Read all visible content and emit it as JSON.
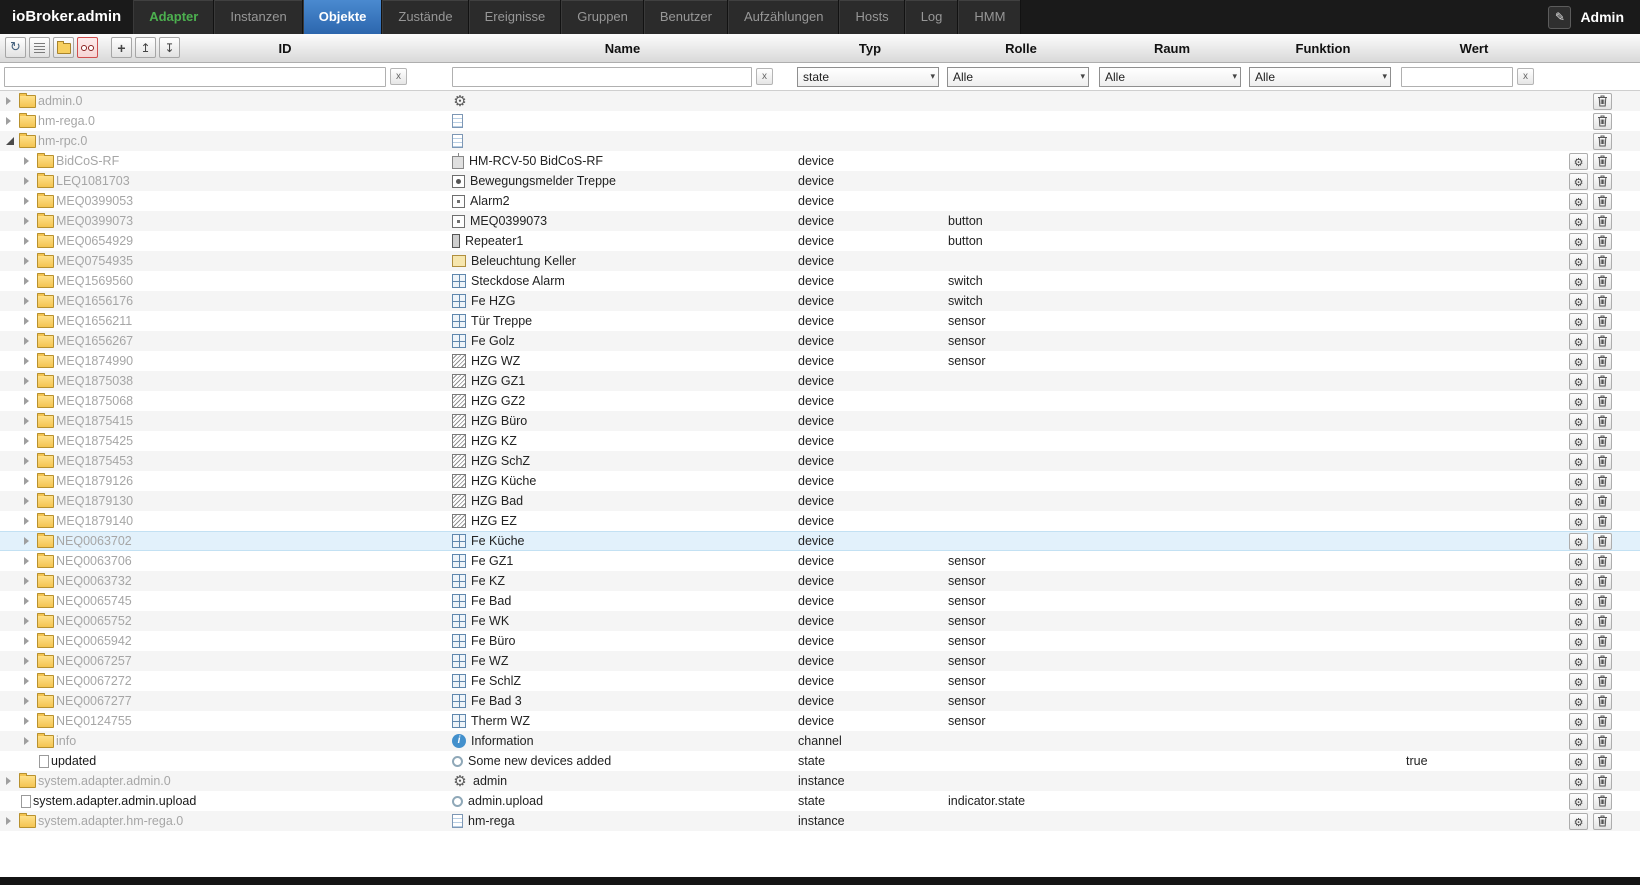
{
  "app": {
    "title": "ioBroker.admin",
    "user": "Admin"
  },
  "tabs": [
    {
      "id": "adapter",
      "label": "Adapter",
      "accent": true
    },
    {
      "id": "instanzen",
      "label": "Instanzen"
    },
    {
      "id": "objekte",
      "label": "Objekte",
      "active": true
    },
    {
      "id": "zustaende",
      "label": "Zustände"
    },
    {
      "id": "ereignisse",
      "label": "Ereignisse"
    },
    {
      "id": "gruppen",
      "label": "Gruppen"
    },
    {
      "id": "benutzer",
      "label": "Benutzer"
    },
    {
      "id": "aufzaehlungen",
      "label": "Aufzählungen"
    },
    {
      "id": "hosts",
      "label": "Hosts"
    },
    {
      "id": "log",
      "label": "Log"
    },
    {
      "id": "hmm",
      "label": "HMM"
    }
  ],
  "icons": {
    "refresh": "↻",
    "add": "+",
    "collapse_all": "↥",
    "expand_all": "↧",
    "edit_pencil": "✎",
    "clear": "x",
    "dropdown_arrow": "▾"
  },
  "columns": [
    "ID",
    "Name",
    "Typ",
    "Rolle",
    "Raum",
    "Funktion",
    "Wert"
  ],
  "filters": {
    "id_value": "",
    "name_value": "",
    "type_selected": "state",
    "role_selected": "Alle",
    "room_selected": "Alle",
    "function_selected": "Alle",
    "value_value": ""
  },
  "table": {
    "rows": [
      {
        "id": "admin.0",
        "level": 0,
        "arrow": "collapsed",
        "node": "folder",
        "virtual": true,
        "icon": "gear",
        "name": "",
        "type": "",
        "role": "",
        "value": "",
        "actions": [
          "delete"
        ]
      },
      {
        "id": "hm-rega.0",
        "level": 0,
        "arrow": "collapsed",
        "node": "folder",
        "virtual": true,
        "icon": "doc",
        "name": "",
        "type": "",
        "role": "",
        "value": "",
        "actions": [
          "delete"
        ]
      },
      {
        "id": "hm-rpc.0",
        "level": 0,
        "arrow": "expanded",
        "node": "folder",
        "virtual": true,
        "icon": "doc",
        "name": "",
        "type": "",
        "role": "",
        "value": "",
        "actions": [
          "delete"
        ]
      },
      {
        "id": "BidCoS-RF",
        "level": 1,
        "arrow": "collapsed",
        "node": "folder",
        "virtual": true,
        "icon": "hm",
        "name": "HM-RCV-50 BidCoS-RF",
        "type": "device",
        "role": "",
        "value": "",
        "actions": [
          "edit",
          "delete"
        ]
      },
      {
        "id": "LEQ1081703",
        "level": 1,
        "arrow": "collapsed",
        "node": "folder",
        "virtual": true,
        "icon": "motion",
        "name": "Bewegungsmelder Treppe",
        "type": "device",
        "role": "",
        "value": "",
        "actions": [
          "edit",
          "delete"
        ]
      },
      {
        "id": "MEQ0399053",
        "level": 1,
        "arrow": "collapsed",
        "node": "folder",
        "virtual": true,
        "icon": "square",
        "name": "Alarm2",
        "type": "device",
        "role": "",
        "value": "",
        "actions": [
          "edit",
          "delete"
        ]
      },
      {
        "id": "MEQ0399073",
        "level": 1,
        "arrow": "collapsed",
        "node": "folder",
        "virtual": true,
        "icon": "square",
        "name": "MEQ0399073",
        "type": "device",
        "role": "button",
        "value": "",
        "actions": [
          "edit",
          "delete"
        ]
      },
      {
        "id": "MEQ0654929",
        "level": 1,
        "arrow": "collapsed",
        "node": "folder",
        "virtual": true,
        "icon": "repeater",
        "name": "Repeater1",
        "type": "device",
        "role": "button",
        "value": "",
        "actions": [
          "edit",
          "delete"
        ]
      },
      {
        "id": "MEQ0754935",
        "level": 1,
        "arrow": "collapsed",
        "node": "folder",
        "virtual": true,
        "icon": "light",
        "name": "Beleuchtung Keller",
        "type": "device",
        "role": "",
        "value": "",
        "actions": [
          "edit",
          "delete"
        ]
      },
      {
        "id": "MEQ1569560",
        "level": 1,
        "arrow": "collapsed",
        "node": "folder",
        "virtual": true,
        "icon": "window",
        "name": "Steckdose Alarm",
        "type": "device",
        "role": "switch",
        "value": "",
        "actions": [
          "edit",
          "delete"
        ]
      },
      {
        "id": "MEQ1656176",
        "level": 1,
        "arrow": "collapsed",
        "node": "folder",
        "virtual": true,
        "icon": "window",
        "name": "Fe HZG",
        "type": "device",
        "role": "switch",
        "value": "",
        "actions": [
          "edit",
          "delete"
        ]
      },
      {
        "id": "MEQ1656211",
        "level": 1,
        "arrow": "collapsed",
        "node": "folder",
        "virtual": true,
        "icon": "window",
        "name": "Tür Treppe",
        "type": "device",
        "role": "sensor",
        "value": "",
        "actions": [
          "edit",
          "delete"
        ]
      },
      {
        "id": "MEQ1656267",
        "level": 1,
        "arrow": "collapsed",
        "node": "folder",
        "virtual": true,
        "icon": "window",
        "name": "Fe Golz",
        "type": "device",
        "role": "sensor",
        "value": "",
        "actions": [
          "edit",
          "delete"
        ]
      },
      {
        "id": "MEQ1874990",
        "level": 1,
        "arrow": "collapsed",
        "node": "folder",
        "virtual": true,
        "icon": "radiator",
        "name": "HZG WZ",
        "type": "device",
        "role": "sensor",
        "value": "",
        "actions": [
          "edit",
          "delete"
        ]
      },
      {
        "id": "MEQ1875038",
        "level": 1,
        "arrow": "collapsed",
        "node": "folder",
        "virtual": true,
        "icon": "radiator",
        "name": "HZG GZ1",
        "type": "device",
        "role": "",
        "value": "",
        "actions": [
          "edit",
          "delete"
        ]
      },
      {
        "id": "MEQ1875068",
        "level": 1,
        "arrow": "collapsed",
        "node": "folder",
        "virtual": true,
        "icon": "radiator",
        "name": "HZG GZ2",
        "type": "device",
        "role": "",
        "value": "",
        "actions": [
          "edit",
          "delete"
        ]
      },
      {
        "id": "MEQ1875415",
        "level": 1,
        "arrow": "collapsed",
        "node": "folder",
        "virtual": true,
        "icon": "radiator",
        "name": "HZG Büro",
        "type": "device",
        "role": "",
        "value": "",
        "actions": [
          "edit",
          "delete"
        ]
      },
      {
        "id": "MEQ1875425",
        "level": 1,
        "arrow": "collapsed",
        "node": "folder",
        "virtual": true,
        "icon": "radiator",
        "name": "HZG KZ",
        "type": "device",
        "role": "",
        "value": "",
        "actions": [
          "edit",
          "delete"
        ]
      },
      {
        "id": "MEQ1875453",
        "level": 1,
        "arrow": "collapsed",
        "node": "folder",
        "virtual": true,
        "icon": "radiator",
        "name": "HZG SchZ",
        "type": "device",
        "role": "",
        "value": "",
        "actions": [
          "edit",
          "delete"
        ]
      },
      {
        "id": "MEQ1879126",
        "level": 1,
        "arrow": "collapsed",
        "node": "folder",
        "virtual": true,
        "icon": "radiator",
        "name": "HZG Küche",
        "type": "device",
        "role": "",
        "value": "",
        "actions": [
          "edit",
          "delete"
        ]
      },
      {
        "id": "MEQ1879130",
        "level": 1,
        "arrow": "collapsed",
        "node": "folder",
        "virtual": true,
        "icon": "radiator",
        "name": "HZG Bad",
        "type": "device",
        "role": "",
        "value": "",
        "actions": [
          "edit",
          "delete"
        ]
      },
      {
        "id": "MEQ1879140",
        "level": 1,
        "arrow": "collapsed",
        "node": "folder",
        "virtual": true,
        "icon": "radiator",
        "name": "HZG EZ",
        "type": "device",
        "role": "",
        "value": "",
        "actions": [
          "edit",
          "delete"
        ]
      },
      {
        "id": "NEQ0063702",
        "level": 1,
        "arrow": "collapsed",
        "node": "folder",
        "virtual": true,
        "icon": "window",
        "name": "Fe Küche",
        "type": "device",
        "role": "",
        "value": "",
        "selected": true,
        "actions": [
          "edit",
          "delete"
        ]
      },
      {
        "id": "NEQ0063706",
        "level": 1,
        "arrow": "collapsed",
        "node": "folder",
        "virtual": true,
        "icon": "window",
        "name": "Fe GZ1",
        "type": "device",
        "role": "sensor",
        "value": "",
        "actions": [
          "edit",
          "delete"
        ]
      },
      {
        "id": "NEQ0063732",
        "level": 1,
        "arrow": "collapsed",
        "node": "folder",
        "virtual": true,
        "icon": "window",
        "name": "Fe KZ",
        "type": "device",
        "role": "sensor",
        "value": "",
        "actions": [
          "edit",
          "delete"
        ]
      },
      {
        "id": "NEQ0065745",
        "level": 1,
        "arrow": "collapsed",
        "node": "folder",
        "virtual": true,
        "icon": "window",
        "name": "Fe Bad",
        "type": "device",
        "role": "sensor",
        "value": "",
        "actions": [
          "edit",
          "delete"
        ]
      },
      {
        "id": "NEQ0065752",
        "level": 1,
        "arrow": "collapsed",
        "node": "folder",
        "virtual": true,
        "icon": "window",
        "name": "Fe WK",
        "type": "device",
        "role": "sensor",
        "value": "",
        "actions": [
          "edit",
          "delete"
        ]
      },
      {
        "id": "NEQ0065942",
        "level": 1,
        "arrow": "collapsed",
        "node": "folder",
        "virtual": true,
        "icon": "window",
        "name": "Fe Büro",
        "type": "device",
        "role": "sensor",
        "value": "",
        "actions": [
          "edit",
          "delete"
        ]
      },
      {
        "id": "NEQ0067257",
        "level": 1,
        "arrow": "collapsed",
        "node": "folder",
        "virtual": true,
        "icon": "window",
        "name": "Fe WZ",
        "type": "device",
        "role": "sensor",
        "value": "",
        "actions": [
          "edit",
          "delete"
        ]
      },
      {
        "id": "NEQ0067272",
        "level": 1,
        "arrow": "collapsed",
        "node": "folder",
        "virtual": true,
        "icon": "window",
        "name": "Fe SchlZ",
        "type": "device",
        "role": "sensor",
        "value": "",
        "actions": [
          "edit",
          "delete"
        ]
      },
      {
        "id": "NEQ0067277",
        "level": 1,
        "arrow": "collapsed",
        "node": "folder",
        "virtual": true,
        "icon": "window",
        "name": "Fe Bad 3",
        "type": "device",
        "role": "sensor",
        "value": "",
        "actions": [
          "edit",
          "delete"
        ]
      },
      {
        "id": "NEQ0124755",
        "level": 1,
        "arrow": "collapsed",
        "node": "folder",
        "virtual": true,
        "icon": "window",
        "name": "Therm WZ",
        "type": "device",
        "role": "sensor",
        "value": "",
        "actions": [
          "edit",
          "delete"
        ]
      },
      {
        "id": "info",
        "level": 1,
        "arrow": "collapsed",
        "node": "folder",
        "virtual": true,
        "icon": "info",
        "name": "Information",
        "type": "channel",
        "role": "",
        "value": "",
        "actions": [
          "edit",
          "delete"
        ]
      },
      {
        "id": "updated",
        "level": 1,
        "arrow": "none",
        "node": "doc",
        "virtual": false,
        "icon": "state",
        "name": "Some new devices added",
        "type": "state",
        "role": "",
        "value": "true",
        "actions": [
          "edit",
          "delete"
        ]
      },
      {
        "id": "system.adapter.admin.0",
        "level": 0,
        "arrow": "collapsed",
        "node": "folder",
        "virtual": true,
        "icon": "gear",
        "name": "admin",
        "type": "instance",
        "role": "",
        "value": "",
        "actions": [
          "edit",
          "delete"
        ]
      },
      {
        "id": "system.adapter.admin.upload",
        "level": 0,
        "arrow": "none",
        "node": "doc",
        "virtual": false,
        "icon": "state",
        "name": "admin.upload",
        "type": "state",
        "role": "indicator.state",
        "value": "",
        "actions": [
          "edit",
          "delete"
        ]
      },
      {
        "id": "system.adapter.hm-rega.0",
        "level": 0,
        "arrow": "collapsed",
        "node": "folder",
        "virtual": true,
        "icon": "doc",
        "name": "hm-rega",
        "type": "instance",
        "role": "",
        "value": "",
        "actions": [
          "edit",
          "delete"
        ]
      }
    ]
  }
}
